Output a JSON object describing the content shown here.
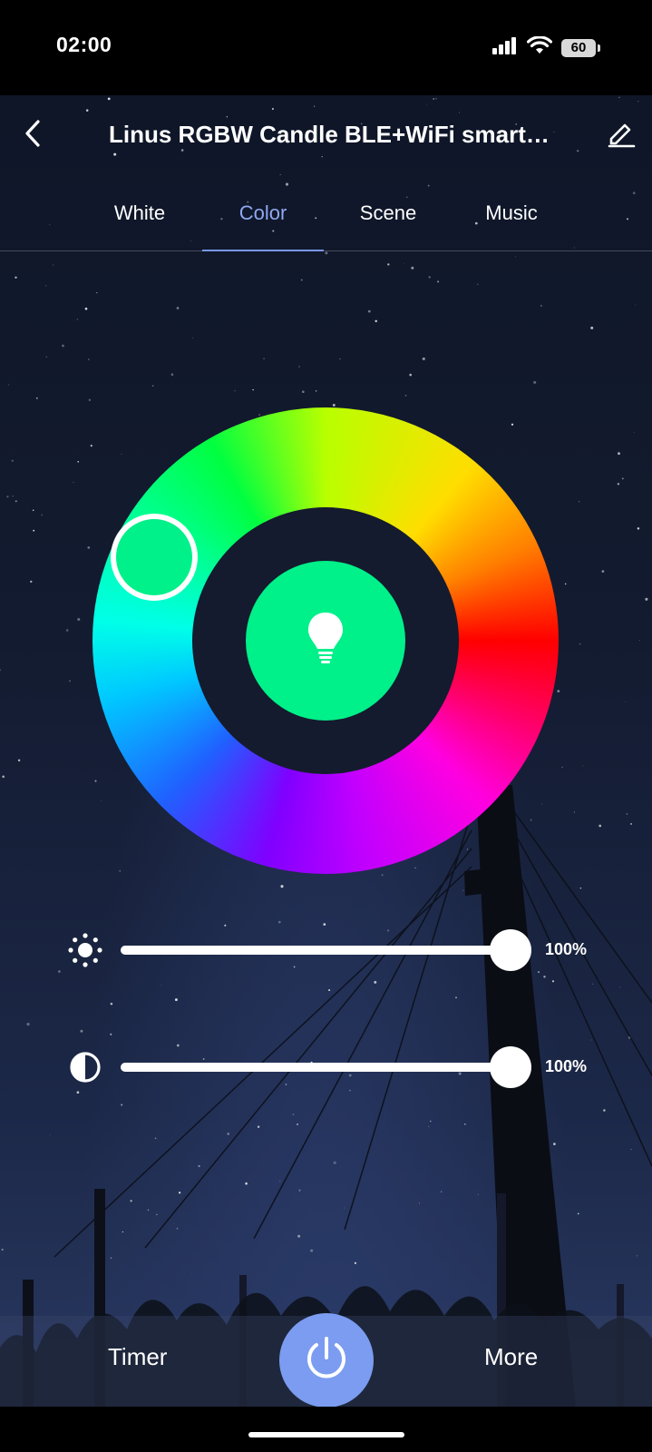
{
  "status_bar": {
    "time": "02:00",
    "battery": "60"
  },
  "header": {
    "title": "Linus RGBW Candle BLE+WiFi smart…"
  },
  "tabs": [
    {
      "label": "White",
      "active": false
    },
    {
      "label": "Color",
      "active": true
    },
    {
      "label": "Scene",
      "active": false
    },
    {
      "label": "Music",
      "active": false
    }
  ],
  "color": {
    "selected_color": "#00f08a"
  },
  "sliders": {
    "brightness": {
      "value_label": "100%",
      "value_percent": 100,
      "icon": "sun-icon"
    },
    "saturation": {
      "value_label": "100%",
      "value_percent": 100,
      "icon": "contrast-icon"
    }
  },
  "bottom": {
    "timer_label": "Timer",
    "more_label": "More",
    "power_icon": "power-icon"
  },
  "colors": {
    "accent": "#7b9cf0",
    "tab_active": "#8fa8f0"
  }
}
